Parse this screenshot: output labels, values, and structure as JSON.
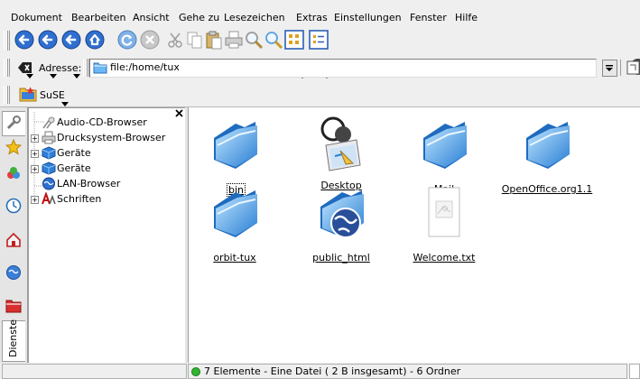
{
  "menubar": {
    "items": [
      {
        "label": "Dokument"
      },
      {
        "label": "Bearbeiten"
      },
      {
        "label": "Ansicht"
      },
      {
        "label": "Gehe zu"
      },
      {
        "label": "Lesezeichen"
      },
      {
        "label": "Extras"
      },
      {
        "label": "Einstellungen"
      },
      {
        "label": "Fenster"
      },
      {
        "label": "Hilfe"
      }
    ]
  },
  "toolbar": {
    "icons": [
      "back-icon",
      "forward-icon",
      "up-icon",
      "home-icon",
      "reload-icon",
      "stop-icon",
      "cut-icon",
      "copy-icon",
      "paste-icon",
      "print-icon",
      "zoom-in-icon",
      "zoom-out-icon",
      "icon-view-icon",
      "list-view-icon"
    ]
  },
  "addressbar": {
    "label": "Adresse:",
    "value": "file:/home/tux"
  },
  "bookmarkbar": {
    "label": "SuSE"
  },
  "sidetabs": {
    "vertical_label": "Dienste"
  },
  "tree": {
    "items": [
      {
        "label": "Audio-CD-Browser"
      },
      {
        "label": "Drucksystem-Browser"
      },
      {
        "label": "Geräte"
      },
      {
        "label": "Geräte"
      },
      {
        "label": "LAN-Browser"
      },
      {
        "label": "Schriften"
      }
    ]
  },
  "files": {
    "items": [
      {
        "label": "bin",
        "type": "folder"
      },
      {
        "label": "Desktop",
        "type": "desktop"
      },
      {
        "label": "Mail",
        "type": "folder"
      },
      {
        "label": "OpenOffice.org1.1",
        "type": "folder"
      },
      {
        "label": "orbit-tux",
        "type": "folder"
      },
      {
        "label": "public_html",
        "type": "web-folder"
      },
      {
        "label": "Welcome.txt",
        "type": "text"
      }
    ]
  },
  "statusbar": {
    "text": "7 Elemente - Eine Datei ( 2 B insgesamt) - 6 Ordner"
  },
  "colors": {
    "folder_light": "#8fd0ff",
    "folder_dark": "#2a7fd4",
    "status_green": "#2fb52f",
    "konq_red": "#c01010"
  }
}
